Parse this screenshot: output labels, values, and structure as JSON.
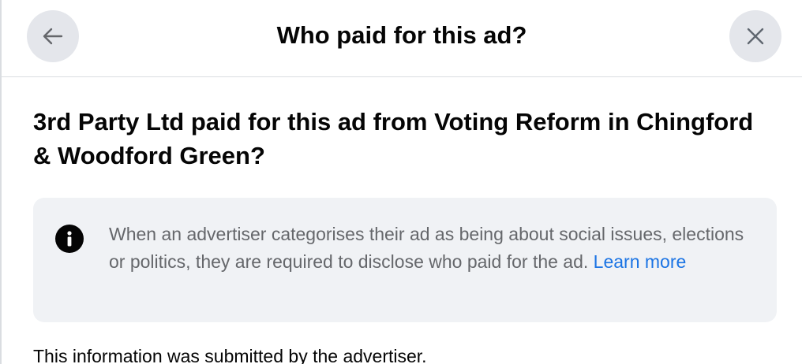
{
  "header": {
    "title": "Who paid for this ad?",
    "back_icon": "arrow-left-icon",
    "close_icon": "close-icon"
  },
  "main": {
    "heading": "3rd Party Ltd paid for this ad from Voting Reform in Chingford & Woodford Green?",
    "info_box": {
      "icon": "info-icon",
      "text": "When an advertiser categorises their ad as being about social issues, elections or politics, they are required to disclose who paid for the ad.",
      "link_label": "Learn more"
    },
    "footer_text": "This information was submitted by the advertiser."
  },
  "colors": {
    "button_bg": "#e4e6eb",
    "info_bg": "#f0f2f5",
    "link": "#1b74e4",
    "secondary_text": "#65676b",
    "divider": "#dadde1"
  }
}
